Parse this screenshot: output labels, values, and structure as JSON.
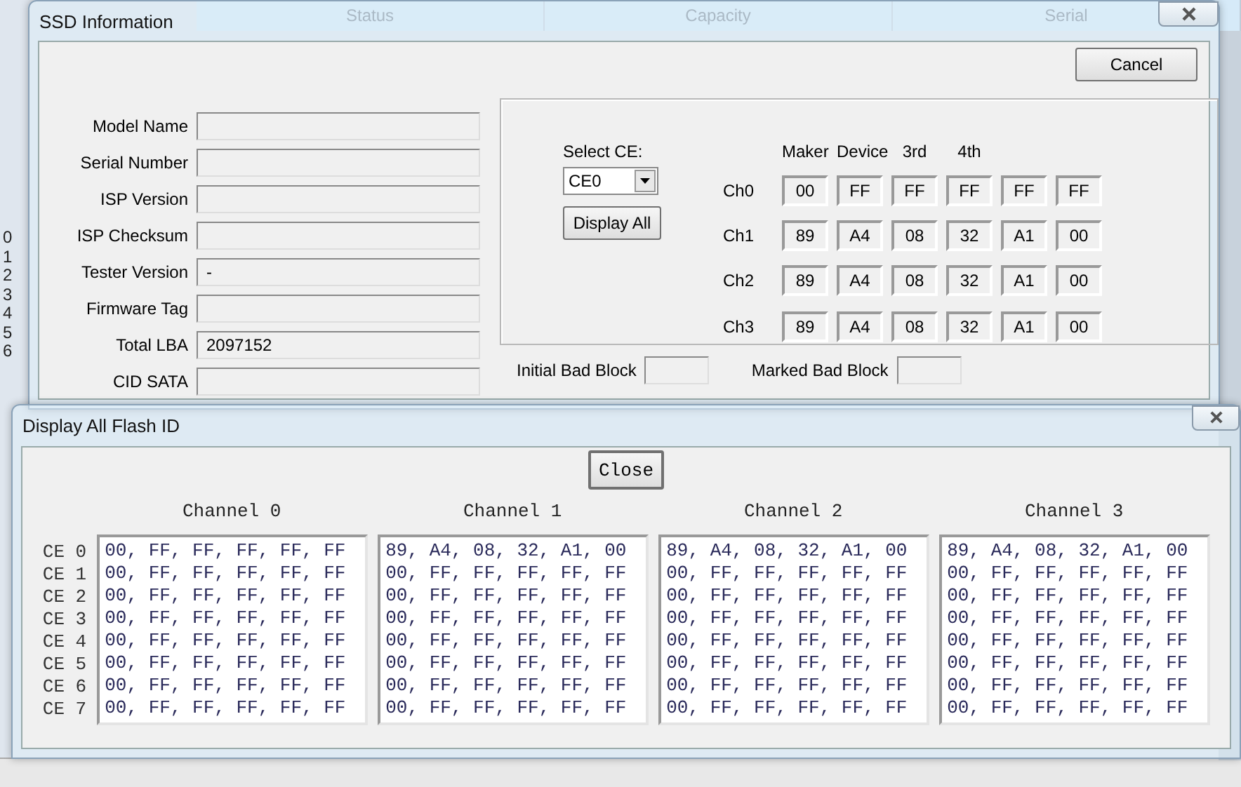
{
  "background": {
    "columns": [
      "Status",
      "Capacity",
      "Serial"
    ],
    "row_numbers": [
      "0",
      "1",
      "2",
      "3",
      "4",
      "5",
      "6"
    ]
  },
  "ssd_window": {
    "title": "SSD Information",
    "cancel": "Cancel",
    "fields": [
      {
        "label": "Model Name"
      },
      {
        "label": "Serial Number"
      },
      {
        "label": "ISP Version"
      },
      {
        "label": "ISP Checksum"
      },
      {
        "label": "Tester Version",
        "value": "-"
      },
      {
        "label": "Firmware Tag"
      },
      {
        "label": "Total LBA",
        "value": "2097152"
      },
      {
        "label": "CID SATA"
      }
    ],
    "select_ce": {
      "label": "Select CE:",
      "value": "CE0"
    },
    "display_all": "Display All",
    "id_headers": [
      "Maker",
      "Device",
      "3rd",
      "4th"
    ],
    "channels": [
      {
        "label": "Ch0",
        "bytes": [
          "00",
          "FF",
          "FF",
          "FF",
          "FF",
          "FF"
        ]
      },
      {
        "label": "Ch1",
        "bytes": [
          "89",
          "A4",
          "08",
          "32",
          "A1",
          "00"
        ]
      },
      {
        "label": "Ch2",
        "bytes": [
          "89",
          "A4",
          "08",
          "32",
          "A1",
          "00"
        ]
      },
      {
        "label": "Ch3",
        "bytes": [
          "89",
          "A4",
          "08",
          "32",
          "A1",
          "00"
        ]
      }
    ],
    "bad_blocks": [
      {
        "label": "Initial Bad Block"
      },
      {
        "label": "Marked Bad Block"
      }
    ]
  },
  "flash_window": {
    "title": "Display All Flash ID",
    "close": "Close",
    "ce_labels": [
      "CE 0",
      "CE 1",
      "CE 2",
      "CE 3",
      "CE 4",
      "CE 5",
      "CE 6",
      "CE 7"
    ],
    "channels": [
      {
        "title": "Channel 0",
        "rows": [
          "00, FF, FF, FF, FF, FF",
          "00, FF, FF, FF, FF, FF",
          "00, FF, FF, FF, FF, FF",
          "00, FF, FF, FF, FF, FF",
          "00, FF, FF, FF, FF, FF",
          "00, FF, FF, FF, FF, FF",
          "00, FF, FF, FF, FF, FF",
          "00, FF, FF, FF, FF, FF"
        ]
      },
      {
        "title": "Channel 1",
        "rows": [
          "89, A4, 08, 32, A1, 00",
          "00, FF, FF, FF, FF, FF",
          "00, FF, FF, FF, FF, FF",
          "00, FF, FF, FF, FF, FF",
          "00, FF, FF, FF, FF, FF",
          "00, FF, FF, FF, FF, FF",
          "00, FF, FF, FF, FF, FF",
          "00, FF, FF, FF, FF, FF"
        ]
      },
      {
        "title": "Channel 2",
        "rows": [
          "89, A4, 08, 32, A1, 00",
          "00, FF, FF, FF, FF, FF",
          "00, FF, FF, FF, FF, FF",
          "00, FF, FF, FF, FF, FF",
          "00, FF, FF, FF, FF, FF",
          "00, FF, FF, FF, FF, FF",
          "00, FF, FF, FF, FF, FF",
          "00, FF, FF, FF, FF, FF"
        ]
      },
      {
        "title": "Channel 3",
        "rows": [
          "89, A4, 08, 32, A1, 00",
          "00, FF, FF, FF, FF, FF",
          "00, FF, FF, FF, FF, FF",
          "00, FF, FF, FF, FF, FF",
          "00, FF, FF, FF, FF, FF",
          "00, FF, FF, FF, FF, FF",
          "00, FF, FF, FF, FF, FF",
          "00, FF, FF, FF, FF, FF"
        ]
      }
    ]
  }
}
